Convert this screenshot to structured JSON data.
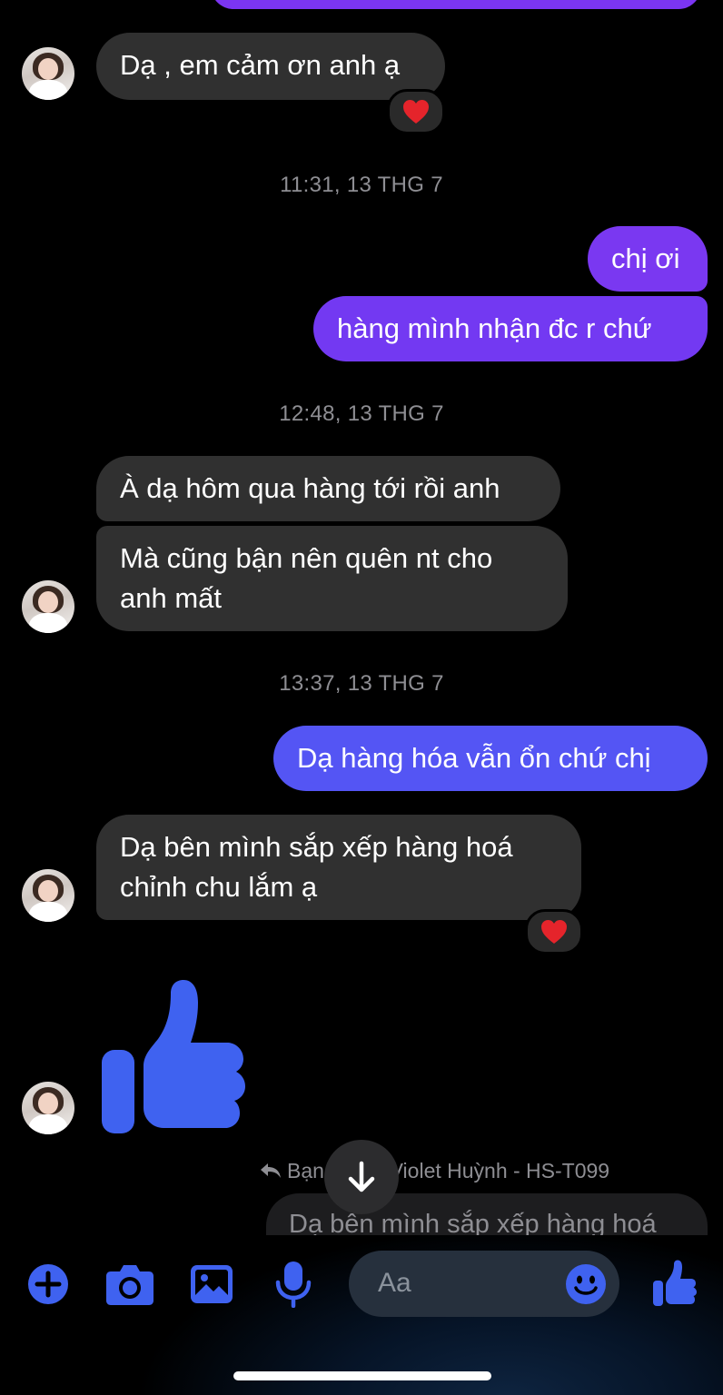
{
  "contact": {
    "name": "Violet Huỳnh - HS-T099"
  },
  "messages": {
    "m1": "Dạ , em cảm ơn anh ạ",
    "t1": "11:31, 13 THG 7",
    "m2": "chị ơi",
    "m3": "hàng mình nhận đc r chứ",
    "t2": "12:48, 13 THG 7",
    "m4": "À dạ hôm qua hàng tới rồi anh",
    "m5_l1": "Mà cũng bận nên quên nt cho",
    "m5_l2": "anh mất",
    "t3": "13:37, 13 THG 7",
    "m6": "Dạ hàng hóa vẫn ổn chứ chị",
    "m7_l1": "Dạ bên mình sắp xếp hàng hoá",
    "m7_l2": "chỉnh chu lắm ạ"
  },
  "reply": {
    "label_start": "Bạn",
    "label_end": "lời Violet Huỳnh - HS-T099",
    "quoted": "Dạ bên mình sắp xếp hàng hoá"
  },
  "composer": {
    "placeholder": "Aa"
  },
  "icons": {
    "reaction": "heart-icon",
    "sticker": "thumbs-up-icon",
    "scroll": "arrow-down-icon",
    "add": "plus-icon",
    "camera": "camera-icon",
    "gallery": "image-icon",
    "mic": "microphone-icon",
    "emoji": "emoji-icon",
    "like": "thumbs-up-icon"
  },
  "colors": {
    "accent": "#3f62f0",
    "outgoing_top": "#7d3bf0",
    "outgoing_bottom": "#5456f4",
    "incoming": "#303030",
    "heart": "#e5242b"
  }
}
